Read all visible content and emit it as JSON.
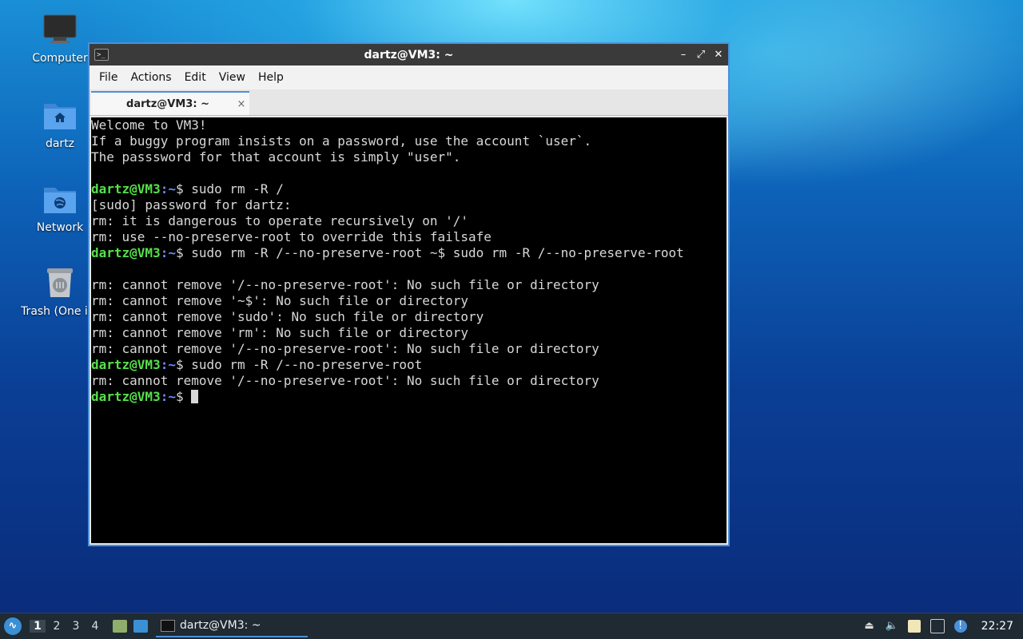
{
  "desktop": {
    "icons": [
      {
        "label": "Computer"
      },
      {
        "label": "dartz"
      },
      {
        "label": "Network"
      },
      {
        "label": "Trash (One ite"
      }
    ]
  },
  "window": {
    "title": "dartz@VM3: ~",
    "menu": [
      "File",
      "Actions",
      "Edit",
      "View",
      "Help"
    ],
    "tab_label": "dartz@VM3: ~",
    "tab_close": "×"
  },
  "terminal": {
    "prompt_user": "dartz@VM3",
    "prompt_path": ":~",
    "prompt_symbol": "$ ",
    "lines": [
      {
        "text": "Welcome to VM3!"
      },
      {
        "text": "If a buggy program insists on a password, use the account `user`."
      },
      {
        "text": "The passsword for that account is simply \"user\"."
      },
      {
        "text": ""
      },
      {
        "prompt": true,
        "text": "sudo rm -R /"
      },
      {
        "text": "[sudo] password for dartz:"
      },
      {
        "text": "rm: it is dangerous to operate recursively on '/'"
      },
      {
        "text": "rm: use --no-preserve-root to override this failsafe"
      },
      {
        "prompt": true,
        "text": "sudo rm -R /--no-preserve-root ~$ sudo rm -R /--no-preserve-root"
      },
      {
        "text": ""
      },
      {
        "text": "rm: cannot remove '/--no-preserve-root': No such file or directory"
      },
      {
        "text": "rm: cannot remove '~$': No such file or directory"
      },
      {
        "text": "rm: cannot remove 'sudo': No such file or directory"
      },
      {
        "text": "rm: cannot remove 'rm': No such file or directory"
      },
      {
        "text": "rm: cannot remove '/--no-preserve-root': No such file or directory"
      },
      {
        "prompt": true,
        "text": "sudo rm -R /--no-preserve-root"
      },
      {
        "text": "rm: cannot remove '/--no-preserve-root': No such file or directory"
      },
      {
        "prompt": true,
        "text": "",
        "cursor": true
      }
    ]
  },
  "taskbar": {
    "workspaces": [
      "1",
      "2",
      "3",
      "4"
    ],
    "active_workspace": "1",
    "task_label": "dartz@VM3: ~",
    "clock": "22:27"
  },
  "colors": {
    "prompt_user": "#55e04a",
    "prompt_path": "#6a8cff",
    "window_border": "#4a90d9"
  }
}
